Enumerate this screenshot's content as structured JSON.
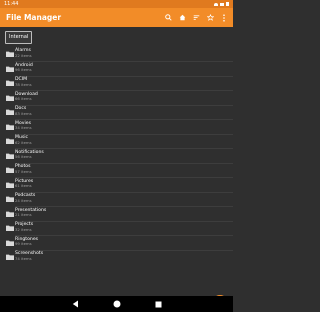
{
  "status_bar": {
    "time": "11:44"
  },
  "toolbar": {
    "title": "File Manager",
    "icons": [
      "search-icon",
      "home-icon",
      "sort-icon",
      "star-icon",
      "more-vert-icon"
    ]
  },
  "breadcrumb": {
    "chip_label": "Internal"
  },
  "folders": [
    {
      "name": "Alarms",
      "count": "22 items"
    },
    {
      "name": "Android",
      "count": "96 items"
    },
    {
      "name": "DCIM",
      "count": "78 items"
    },
    {
      "name": "Download",
      "count": "66 items"
    },
    {
      "name": "Docs",
      "count": "83 items"
    },
    {
      "name": "Movies",
      "count": "34 items"
    },
    {
      "name": "Music",
      "count": "62 items"
    },
    {
      "name": "Notifications",
      "count": "56 items"
    },
    {
      "name": "Photos",
      "count": "57 items"
    },
    {
      "name": "Pictures",
      "count": "61 items"
    },
    {
      "name": "Podcasts",
      "count": "24 items"
    },
    {
      "name": "Presentations",
      "count": "21 items"
    },
    {
      "name": "Projects",
      "count": "32 items"
    },
    {
      "name": "Ringtones",
      "count": "99 items"
    },
    {
      "name": "Screenshots",
      "count": "74 items"
    }
  ],
  "fab": {
    "label": "+"
  },
  "colors": {
    "accent": "#f28c28",
    "status": "#e07a1f",
    "background": "#2f2f2f",
    "folder": "#d9d9d9"
  }
}
